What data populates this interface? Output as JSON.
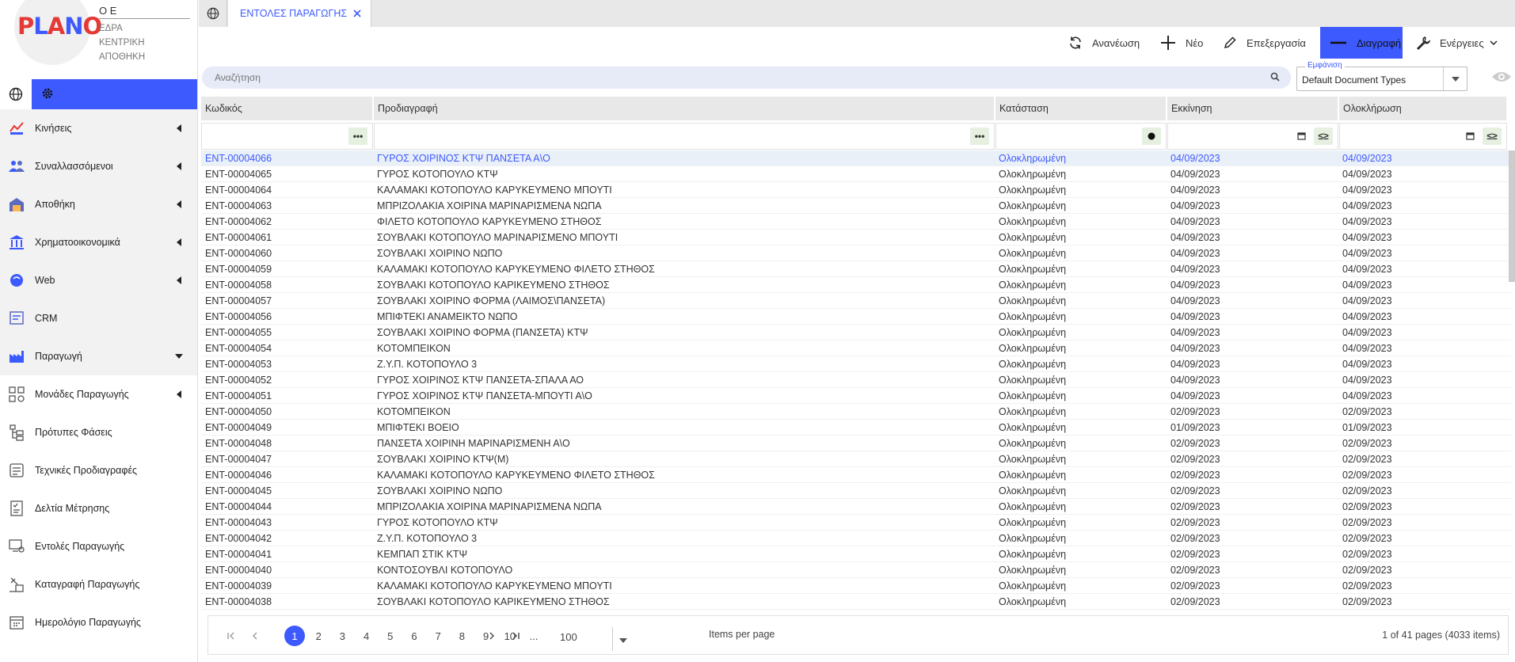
{
  "company": {
    "logo": "PLANO",
    "name": "Ο Ε",
    "lines": [
      "ΕΔΡΑ",
      "ΚΕΝΤΡΙΚΗ",
      "ΑΠΟΘΗΚΗ"
    ]
  },
  "sidebar": {
    "items": [
      {
        "label": "Κινήσεις",
        "icon": "movements-icon",
        "arrow": "left",
        "sub": false
      },
      {
        "label": "Συναλλασσόμενοι",
        "icon": "people-icon",
        "arrow": "left",
        "sub": false
      },
      {
        "label": "Αποθήκη",
        "icon": "warehouse-icon",
        "arrow": "left",
        "sub": false
      },
      {
        "label": "Χρηματοοικονομικά",
        "icon": "bank-icon",
        "arrow": "left",
        "sub": false
      },
      {
        "label": "Web",
        "icon": "web-icon",
        "arrow": "left",
        "sub": false
      },
      {
        "label": "CRM",
        "icon": "crm-icon",
        "arrow": "",
        "sub": false
      },
      {
        "label": "Παραγωγή",
        "icon": "production-icon",
        "arrow": "down",
        "sub": false
      },
      {
        "label": "Μονάδες Παραγωγής",
        "icon": "units-icon",
        "arrow": "left",
        "sub": true
      },
      {
        "label": "Πρότυπες Φάσεις",
        "icon": "phases-icon",
        "arrow": "",
        "sub": true
      },
      {
        "label": "Τεχνικές Προδιαγραφές",
        "icon": "specs-icon",
        "arrow": "",
        "sub": true
      },
      {
        "label": "Δελτία Μέτρησης",
        "icon": "measure-icon",
        "arrow": "",
        "sub": true
      },
      {
        "label": "Εντολές Παραγωγής",
        "icon": "orders-icon",
        "arrow": "",
        "sub": true
      },
      {
        "label": "Καταγραφή Παραγωγής",
        "icon": "record-icon",
        "arrow": "",
        "sub": true
      },
      {
        "label": "Ημερολόγιο Παραγωγής",
        "icon": "calendar-icon",
        "arrow": "",
        "sub": true
      }
    ]
  },
  "tabs": {
    "active_label": "ΕΝΤΟΛΕΣ ΠΑΡΑΓΩΓΗΣ"
  },
  "toolbar": {
    "refresh": "Ανανέωση",
    "new": "Νέο",
    "edit": "Επεξεργασία",
    "delete": "Διαγραφή",
    "actions": "Ενέργειες"
  },
  "search": {
    "placeholder": "Αναζήτηση",
    "value": ""
  },
  "view": {
    "label": "Εμφάνιση",
    "value": "Default Document Types"
  },
  "grid": {
    "columns": [
      "Κωδικός",
      "Προδιαγραφή",
      "Κατάσταση",
      "Εκκίνηση",
      "Ολοκλήρωση"
    ],
    "rows": [
      [
        "ENT-00004066",
        "ΓΥΡΟΣ ΧΟΙΡΙΝΟΣ ΚΤΨ ΠΑΝΣΕΤΑ Α\\Ο",
        "Ολοκληρωμένη",
        "04/09/2023",
        "04/09/2023"
      ],
      [
        "ENT-00004065",
        "ΓΥΡΟΣ ΚΟΤΟΠΟΥΛΟ ΚΤΨ",
        "Ολοκληρωμένη",
        "04/09/2023",
        "04/09/2023"
      ],
      [
        "ENT-00004064",
        "ΚΑΛΑΜΑΚΙ ΚΟΤΟΠΟΥΛΟ ΚΑΡΥΚΕΥΜΕΝΟ ΜΠΟΥΤΙ",
        "Ολοκληρωμένη",
        "04/09/2023",
        "04/09/2023"
      ],
      [
        "ENT-00004063",
        "ΜΠΡΙΖΟΛΑΚΙΑ ΧΟΙΡΙΝΑ ΜΑΡΙΝΑΡΙΣΜΕΝΑ ΝΩΠΑ",
        "Ολοκληρωμένη",
        "04/09/2023",
        "04/09/2023"
      ],
      [
        "ENT-00004062",
        "ΦΙΛΕΤΟ ΚΟΤΟΠΟΥΛΟ ΚΑΡΥΚΕΥΜΕΝΟ ΣΤΗΘΟΣ",
        "Ολοκληρωμένη",
        "04/09/2023",
        "04/09/2023"
      ],
      [
        "ENT-00004061",
        "ΣΟΥΒΛΑΚΙ ΚΟΤΟΠΟΥΛΟ ΜΑΡΙΝΑΡΙΣΜΕΝΟ ΜΠΟΥΤΙ",
        "Ολοκληρωμένη",
        "04/09/2023",
        "04/09/2023"
      ],
      [
        "ENT-00004060",
        "ΣΟΥΒΛΑΚΙ ΧΟΙΡΙΝΟ ΝΩΠΟ",
        "Ολοκληρωμένη",
        "04/09/2023",
        "04/09/2023"
      ],
      [
        "ENT-00004059",
        "ΚΑΛΑΜΑΚΙ ΚΟΤΟΠΟΥΛΟ ΚΑΡΥΚΕΥΜΕΝΟ ΦΙΛΕΤΟ ΣΤΗΘΟΣ",
        "Ολοκληρωμένη",
        "04/09/2023",
        "04/09/2023"
      ],
      [
        "ENT-00004058",
        "ΣΟΥΒΛΑΚΙ ΚΟΤΟΠΟΥΛΟ ΚΑΡΙΚΕΥΜΕΝΟ ΣΤΗΘΟΣ",
        "Ολοκληρωμένη",
        "04/09/2023",
        "04/09/2023"
      ],
      [
        "ENT-00004057",
        "ΣΟΥΒΛΑΚΙ ΧΟΙΡΙΝΟ ΦΟΡΜΑ (ΛΑΙΜΟΣ\\ΠΑΝΣΕΤΑ)",
        "Ολοκληρωμένη",
        "04/09/2023",
        "04/09/2023"
      ],
      [
        "ENT-00004056",
        "ΜΠΙΦΤΕΚΙ ΑΝΑΜΕΙΚΤΟ ΝΩΠΟ",
        "Ολοκληρωμένη",
        "04/09/2023",
        "04/09/2023"
      ],
      [
        "ENT-00004055",
        "ΣΟΥΒΛΑΚΙ ΧΟΙΡΙΝΟ ΦΟΡΜΑ (ΠΑΝΣΕΤΑ) ΚΤΨ",
        "Ολοκληρωμένη",
        "04/09/2023",
        "04/09/2023"
      ],
      [
        "ENT-00004054",
        "ΚΟΤΟΜΠΕΙΚΟΝ",
        "Ολοκληρωμένη",
        "04/09/2023",
        "04/09/2023"
      ],
      [
        "ENT-00004053",
        "Ζ.Υ.Π. ΚΟΤΟΠΟΥΛΟ 3",
        "Ολοκληρωμένη",
        "04/09/2023",
        "04/09/2023"
      ],
      [
        "ENT-00004052",
        "ΓΥΡΟΣ ΧΟΙΡΙΝΟΣ ΚΤΨ ΠΑΝΣΕΤΑ-ΣΠΑΛΑ ΑΟ",
        "Ολοκληρωμένη",
        "04/09/2023",
        "04/09/2023"
      ],
      [
        "ENT-00004051",
        "ΓΥΡΟΣ ΧΟΙΡΙΝΟΣ ΚΤΨ ΠΑΝΣΕΤΑ-ΜΠΟΥΤΙ Α\\Ο",
        "Ολοκληρωμένη",
        "04/09/2023",
        "04/09/2023"
      ],
      [
        "ENT-00004050",
        "ΚΟΤΟΜΠΕΙΚΟΝ",
        "Ολοκληρωμένη",
        "02/09/2023",
        "02/09/2023"
      ],
      [
        "ENT-00004049",
        "ΜΠΙΦΤΕΚΙ ΒΟΕΙΟ",
        "Ολοκληρωμένη",
        "01/09/2023",
        "01/09/2023"
      ],
      [
        "ENT-00004048",
        "ΠΑΝΣΕΤΑ ΧΟΙΡΙΝΗ ΜΑΡΙΝΑΡΙΣΜΕΝΗ Α\\Ο",
        "Ολοκληρωμένη",
        "02/09/2023",
        "02/09/2023"
      ],
      [
        "ENT-00004047",
        "ΣΟΥΒΛΑΚΙ ΧΟΙΡΙΝΟ ΚΤΨ(Μ)",
        "Ολοκληρωμένη",
        "02/09/2023",
        "02/09/2023"
      ],
      [
        "ENT-00004046",
        "ΚΑΛΑΜΑΚΙ ΚΟΤΟΠΟΥΛΟ ΚΑΡΥΚΕΥΜΕΝΟ ΦΙΛΕΤΟ ΣΤΗΘΟΣ",
        "Ολοκληρωμένη",
        "02/09/2023",
        "02/09/2023"
      ],
      [
        "ENT-00004045",
        "ΣΟΥΒΛΑΚΙ ΧΟΙΡΙΝΟ ΝΩΠΟ",
        "Ολοκληρωμένη",
        "02/09/2023",
        "02/09/2023"
      ],
      [
        "ENT-00004044",
        "ΜΠΡΙΖΟΛΑΚΙΑ ΧΟΙΡΙΝΑ ΜΑΡΙΝΑΡΙΣΜΕΝΑ ΝΩΠΑ",
        "Ολοκληρωμένη",
        "02/09/2023",
        "02/09/2023"
      ],
      [
        "ENT-00004043",
        "ΓΥΡΟΣ ΚΟΤΟΠΟΥΛΟ ΚΤΨ",
        "Ολοκληρωμένη",
        "02/09/2023",
        "02/09/2023"
      ],
      [
        "ENT-00004042",
        "Ζ.Υ.Π. ΚΟΤΟΠΟΥΛΟ 3",
        "Ολοκληρωμένη",
        "02/09/2023",
        "02/09/2023"
      ],
      [
        "ENT-00004041",
        "ΚΕΜΠΑΠ ΣΤΙΚ ΚΤΨ",
        "Ολοκληρωμένη",
        "02/09/2023",
        "02/09/2023"
      ],
      [
        "ENT-00004040",
        "ΚΟΝΤΟΣΟΥΒΛΙ ΚΟΤΟΠΟΥΛΟ",
        "Ολοκληρωμένη",
        "02/09/2023",
        "02/09/2023"
      ],
      [
        "ENT-00004039",
        "ΚΑΛΑΜΑΚΙ ΚΟΤΟΠΟΥΛΟ ΚΑΡΥΚΕΥΜΕΝΟ ΜΠΟΥΤΙ",
        "Ολοκληρωμένη",
        "02/09/2023",
        "02/09/2023"
      ],
      [
        "ENT-00004038",
        "ΣΟΥΒΛΑΚΙ ΚΟΤΟΠΟΥΛΟ ΚΑΡΙΚΕΥΜΕΝΟ ΣΤΗΘΟΣ",
        "Ολοκληρωμένη",
        "02/09/2023",
        "02/09/2023"
      ]
    ],
    "selected_row": 0
  },
  "pager": {
    "pages": [
      "1",
      "2",
      "3",
      "4",
      "5",
      "6",
      "7",
      "8",
      "9",
      "10",
      "..."
    ],
    "current": "1",
    "per_page": "100",
    "items_per_page_label": "Items per page",
    "info": "1 of 41 pages (4033 items)"
  },
  "colors": {
    "accent": "#3d5afe",
    "logo_red": "#e53935",
    "logo_blue": "#3d5afe"
  }
}
